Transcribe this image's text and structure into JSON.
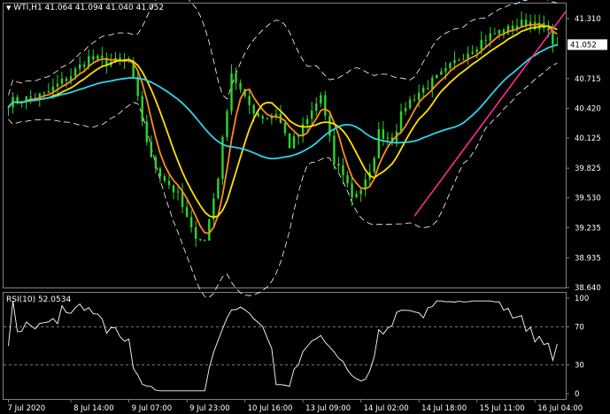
{
  "header": {
    "symbol": "WTI,H1",
    "ohlc": "41.064 41.094 41.040 41.052",
    "indicator": "RSI(10) 52.0534"
  },
  "colors": {
    "background": "#000000",
    "frame": "#808080",
    "candles": "#2bd62b",
    "ma_fast": "#ff8c1a",
    "ma_mid": "#ffe100",
    "ma_slow": "#2fd5e6",
    "bands": "#ffffff",
    "trendline": "#ff2d95",
    "rsi_line": "#ffffff",
    "price_tag_bg": "#ffffff",
    "price_tag_text": "#000000"
  },
  "chart_data": {
    "type": "line",
    "main": {
      "y_ticks": [
        "41.310",
        "40.715",
        "40.420",
        "40.125",
        "39.825",
        "39.530",
        "39.235",
        "38.935",
        "38.640"
      ],
      "y_tick_values": [
        41.31,
        40.715,
        40.42,
        40.125,
        39.825,
        39.53,
        39.235,
        38.935,
        38.64
      ],
      "ylim": [
        38.64,
        41.46
      ],
      "current_price": "41.052",
      "current_price_value": 41.052,
      "x_ticks": [
        "7 Jul 2020",
        "8 Jul 14:00",
        "9 Jul 07:00",
        "9 Jul 23:00",
        "10 Jul 16:00",
        "13 Jul 09:00",
        "14 Jul 02:00",
        "14 Jul 18:00",
        "15 Jul 11:00",
        "16 Jul 04:00"
      ],
      "x_tick_positions": [
        0,
        14,
        27,
        40,
        53,
        66,
        79,
        92,
        105,
        118
      ],
      "bar_count": 124,
      "anchors_x": [
        0,
        8,
        14,
        18,
        22,
        27,
        29,
        32,
        35,
        38,
        41,
        44,
        47,
        50,
        53,
        56,
        58,
        60,
        63,
        65,
        67,
        70,
        73,
        75,
        77,
        79,
        81,
        83,
        86,
        89,
        92,
        95,
        98,
        101,
        104,
        107,
        110,
        112,
        114,
        117,
        120,
        123
      ],
      "anchors_close": [
        40.48,
        40.55,
        40.75,
        40.92,
        40.88,
        40.88,
        40.5,
        39.9,
        39.72,
        39.55,
        39.2,
        39.1,
        39.75,
        40.78,
        40.5,
        40.35,
        40.33,
        40.38,
        40.05,
        40.15,
        40.3,
        40.55,
        39.88,
        39.78,
        39.55,
        39.62,
        39.75,
        40.18,
        40.12,
        40.45,
        40.58,
        40.68,
        40.78,
        40.92,
        41.02,
        41.12,
        41.18,
        41.2,
        41.25,
        41.28,
        41.2,
        41.052
      ],
      "series": [
        {
          "name": "",
          "kind": "ma",
          "period": 5,
          "color_key": "ma_fast"
        },
        {
          "name": "",
          "kind": "ma",
          "period": 10,
          "color_key": "ma_mid"
        },
        {
          "name": "",
          "kind": "ma",
          "period": 30,
          "color_key": "ma_slow"
        },
        {
          "name": "",
          "kind": "bands",
          "period": 20,
          "deviation": 2,
          "color_key": "bands"
        }
      ],
      "trendline": {
        "x1": 91,
        "y1": 39.35,
        "x2": 128,
        "y2": 41.38
      }
    },
    "rsi": {
      "levels_ticks": [
        "100",
        "70",
        "30",
        "0"
      ],
      "level_values": [
        100,
        70,
        30,
        0
      ],
      "dashed_levels": [
        70,
        30
      ],
      "period": 10,
      "last_value": 52.0534
    }
  }
}
